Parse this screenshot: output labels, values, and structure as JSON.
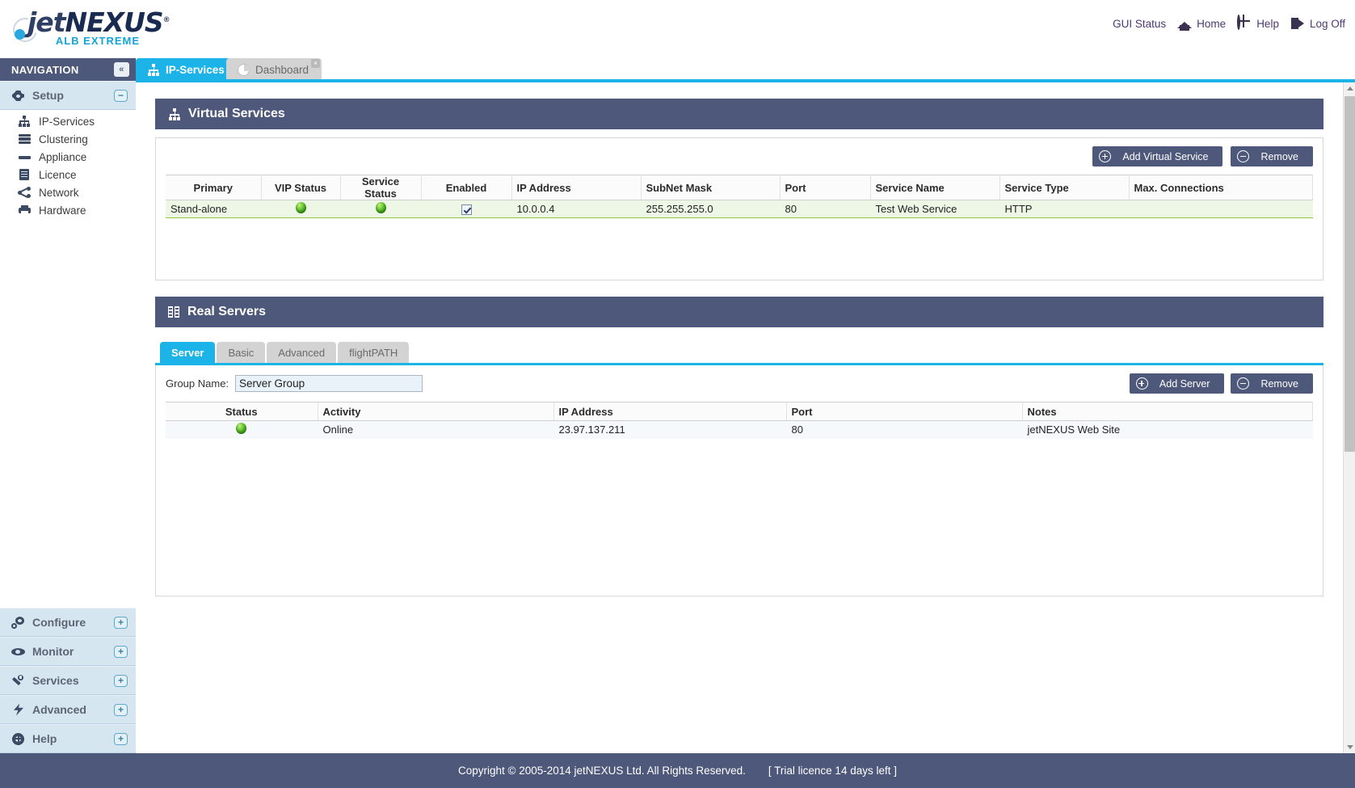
{
  "brand": {
    "logo_main_1": "jet",
    "logo_main_2": "NEXUS",
    "logo_reg": "®",
    "logo_sub": "ALB EXTREME",
    "accent": "#1bb3e8",
    "panel_dark": "#4e587a",
    "status_green": "#49b21c",
    "row_select_border": "#8dc63f"
  },
  "header": {
    "links": [
      {
        "label": "GUI Status",
        "icon": "status-check-icon"
      },
      {
        "label": "Home",
        "icon": "home-icon"
      },
      {
        "label": "Help",
        "icon": "help-lifering-icon"
      },
      {
        "label": "Log Off",
        "icon": "logoff-icon"
      }
    ]
  },
  "tabs": [
    {
      "label": "IP-Services",
      "icon": "tree-icon",
      "active": true,
      "closable": false
    },
    {
      "label": "Dashboard",
      "icon": "pie-chart-icon",
      "active": false,
      "closable": true,
      "close_glyph": "×"
    }
  ],
  "sidebar": {
    "title": "NAVIGATION",
    "collapse_glyph": "«",
    "sections": [
      {
        "label": "Setup",
        "icon": "gear-icon",
        "toggle": "−",
        "expanded": true,
        "items": [
          {
            "label": "IP-Services",
            "icon": "tree-icon",
            "active": true
          },
          {
            "label": "Clustering",
            "icon": "stack-icon"
          },
          {
            "label": "Appliance",
            "icon": "appliance-icon"
          },
          {
            "label": "Licence",
            "icon": "document-icon"
          },
          {
            "label": "Network",
            "icon": "share-icon"
          },
          {
            "label": "Hardware",
            "icon": "printer-icon"
          }
        ]
      }
    ],
    "sections_lower": [
      {
        "label": "Configure",
        "icon": "gears-icon",
        "toggle": "+"
      },
      {
        "label": "Monitor",
        "icon": "eye-icon",
        "toggle": "+"
      },
      {
        "label": "Services",
        "icon": "wrench-icon",
        "toggle": "+"
      },
      {
        "label": "Advanced",
        "icon": "bolt-icon",
        "toggle": "+"
      },
      {
        "label": "Help",
        "icon": "help-lifering-icon",
        "toggle": "+"
      }
    ]
  },
  "virtual_services": {
    "title": "Virtual Services",
    "icon": "tree-icon",
    "add_label": "Add Virtual Service",
    "remove_label": "Remove",
    "columns": [
      "Primary",
      "VIP Status",
      "Service Status",
      "Enabled",
      "IP Address",
      "SubNet Mask",
      "Port",
      "Service Name",
      "Service Type",
      "Max. Connections"
    ],
    "rows": [
      {
        "primary": "Stand-alone",
        "vip_status": "online",
        "service_status": "online",
        "enabled": true,
        "ip_address": "10.0.0.4",
        "subnet_mask": "255.255.255.0",
        "port": "80",
        "service_name": "Test Web Service",
        "service_type": "HTTP",
        "max_connections": "",
        "selected": true
      }
    ]
  },
  "real_servers": {
    "title": "Real Servers",
    "icon": "servers-icon",
    "tabs": [
      {
        "label": "Server",
        "active": true
      },
      {
        "label": "Basic",
        "active": false
      },
      {
        "label": "Advanced",
        "active": false
      },
      {
        "label": "flightPATH",
        "active": false
      }
    ],
    "group_name_label": "Group Name:",
    "group_name_value": "Server Group",
    "add_label": "Add Server",
    "remove_label": "Remove",
    "columns": [
      "Status",
      "Activity",
      "IP Address",
      "Port",
      "Notes"
    ],
    "rows": [
      {
        "status": "online",
        "activity": "Online",
        "ip_address": "23.97.137.211",
        "port": "80",
        "notes": "jetNEXUS Web Site"
      }
    ]
  },
  "footer": {
    "copyright": "Copyright © 2005-2014 jetNEXUS Ltd. All Rights Reserved.",
    "licence": "[ Trial licence 14 days left ]"
  }
}
